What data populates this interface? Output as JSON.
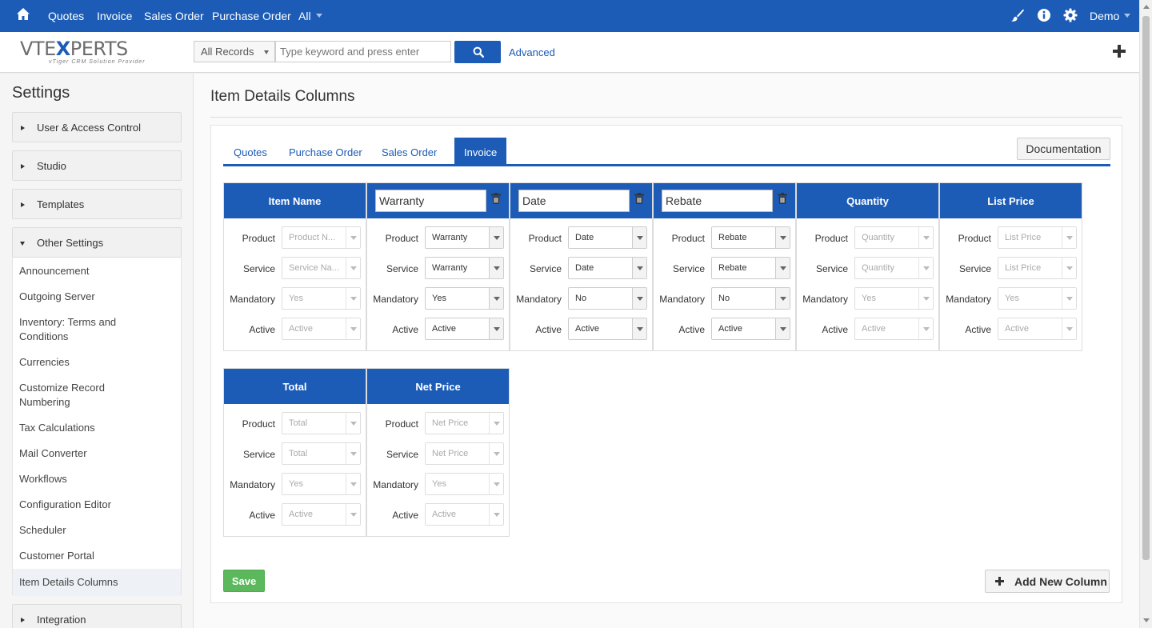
{
  "topnav": {
    "items": [
      "Quotes",
      "Invoice",
      "Sales Order",
      "Purchase Order"
    ],
    "all_label": "All",
    "user_label": "Demo"
  },
  "header": {
    "logo_brand_start": "VTE",
    "logo_brand_x": "X",
    "logo_brand_end": "PERTS",
    "logo_tagline": "vTiger CRM Solution Provider",
    "records_select": "All Records",
    "search_placeholder": "Type keyword and press enter",
    "advanced_label": "Advanced"
  },
  "sidebar": {
    "title": "Settings",
    "panels": [
      "User & Access Control",
      "Studio",
      "Templates",
      "Other Settings",
      "Integration"
    ],
    "links": [
      "Announcement",
      "Outgoing Server",
      "Inventory: Terms and Conditions",
      "Currencies",
      "Customize Record Numbering",
      "Tax Calculations",
      "Mail Converter",
      "Workflows",
      "Configuration Editor",
      "Scheduler",
      "Customer Portal",
      "Item Details Columns"
    ]
  },
  "main": {
    "title": "Item Details Columns",
    "tabs": [
      "Quotes",
      "Purchase Order",
      "Sales Order",
      "Invoice"
    ],
    "documentation_label": "Documentation",
    "row_labels": [
      "Product",
      "Service",
      "Mandatory",
      "Active"
    ],
    "columns": [
      {
        "header": "Item Name",
        "editable": false,
        "values": [
          "Product N...",
          "Service Na...",
          "Yes",
          "Active"
        ]
      },
      {
        "header": "Warranty",
        "editable": true,
        "values": [
          "Warranty",
          "Warranty",
          "Yes",
          "Active"
        ]
      },
      {
        "header": "Date",
        "editable": true,
        "values": [
          "Date",
          "Date",
          "No",
          "Active"
        ]
      },
      {
        "header": "Rebate",
        "editable": true,
        "values": [
          "Rebate",
          "Rebate",
          "No",
          "Active"
        ]
      },
      {
        "header": "Quantity",
        "editable": false,
        "values": [
          "Quantity",
          "Quantity",
          "Yes",
          "Active"
        ]
      },
      {
        "header": "List Price",
        "editable": false,
        "values": [
          "List Price",
          "List Price",
          "Yes",
          "Active"
        ]
      },
      {
        "header": "Total",
        "editable": false,
        "values": [
          "Total",
          "Total",
          "Yes",
          "Active"
        ]
      },
      {
        "header": "Net Price",
        "editable": false,
        "values": [
          "Net Price",
          "Net Price",
          "Yes",
          "Active"
        ]
      }
    ],
    "save_label": "Save",
    "add_column_label": "Add New Column"
  },
  "colors": {
    "primary": "#1c5cb6",
    "success": "#5cb85c"
  }
}
